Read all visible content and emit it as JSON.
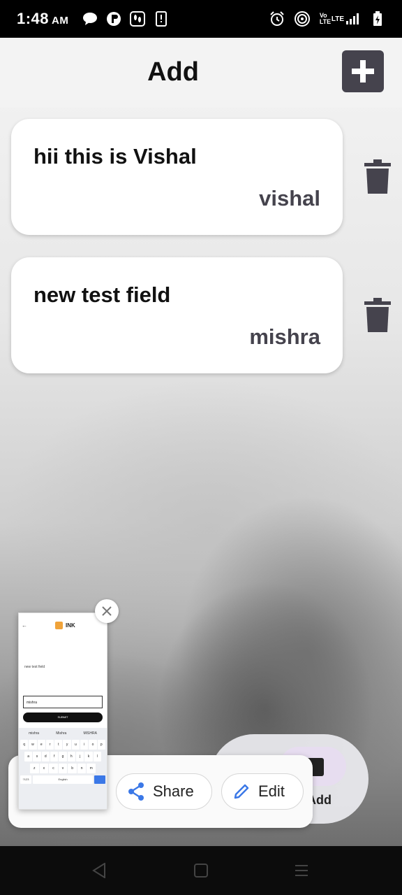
{
  "status_bar": {
    "time": "1:48",
    "ampm": "AM",
    "left_icons": [
      "chat-bubble-icon",
      "app-r-icon",
      "feet-icon",
      "phone-icon"
    ],
    "right_icons": [
      "alarm-icon",
      "hotspot-icon",
      "volte-lte-signal-icon",
      "battery-icon"
    ],
    "volte_label": "Vo LTE",
    "lte_label": "LTE"
  },
  "header": {
    "title": "Add",
    "add_icon": "plus-icon"
  },
  "notes": [
    {
      "title": "hii this is Vishal",
      "author": "vishal"
    },
    {
      "title": "new test field",
      "author": "mishra"
    }
  ],
  "screenshot_thumb": {
    "title": "INK",
    "input_value": "mishra",
    "note_text": "new test field",
    "submit_label": "SUBMIT",
    "suggestions": [
      "mishra",
      "Mishra",
      "MISHRA"
    ],
    "keyboard_row1": [
      "q",
      "w",
      "e",
      "r",
      "t",
      "y",
      "u",
      "i",
      "o",
      "p"
    ],
    "keyboard_row2": [
      "a",
      "s",
      "d",
      "f",
      "g",
      "h",
      "j",
      "k",
      "l"
    ],
    "keyboard_row3": [
      "z",
      "x",
      "c",
      "v",
      "b",
      "n",
      "m"
    ],
    "keyboard_bottom": [
      "?123",
      "English"
    ]
  },
  "bottom_nav": {
    "label": "Add"
  },
  "actions": {
    "share": "Share",
    "edit": "Edit"
  },
  "colors": {
    "accent": "#45434d",
    "nav_bg": "#0c0c0c"
  }
}
